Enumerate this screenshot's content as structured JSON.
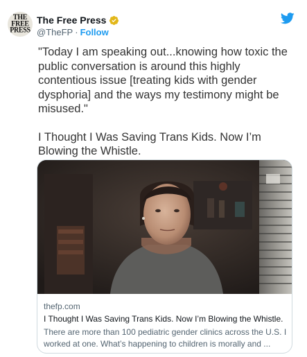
{
  "account": {
    "avatar_text": "THE\nFREE\nPRESS",
    "display_name": "The Free Press",
    "handle": "@TheFP",
    "separator": "·",
    "follow_label": "Follow"
  },
  "tweet": {
    "quote": "\"Today I am speaking out...knowing how toxic the public conversation is around this highly contentious issue [treating kids with gender dysphoria] and the ways my testimony might be misused.\"",
    "headline": "I Thought I Was Saving Trans Kids. Now I’m Blowing the Whistle."
  },
  "card": {
    "domain": "thefp.com",
    "title": "I Thought I Was Saving Trans Kids. Now I’m Blowing the Whistle.",
    "description": "There are more than 100 pediatric gender clinics across the U.S. I worked at one. What’s happening to children is morally and ..."
  },
  "colors": {
    "accent": "#1d9bf0",
    "verified": "#e2b719",
    "secondary_text": "#536471"
  },
  "icons": {
    "verified": "verified-badge-icon",
    "brand": "twitter-bird-icon"
  }
}
